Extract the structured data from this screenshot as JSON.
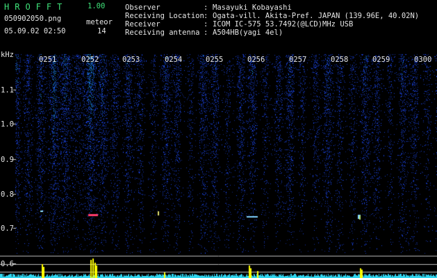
{
  "app": {
    "title": "HROFFT",
    "version": "1.00"
  },
  "capture": {
    "filename": "050902050.png",
    "datetime": "05.09.02 02:50",
    "meteor_label": "meteor",
    "meteor_count": "14"
  },
  "info": [
    {
      "key": "Observer",
      "value": "Masayuki Kobayashi"
    },
    {
      "key": "Receiving Location",
      "value": "Ogata-vill. Akita-Pref. JAPAN (139.96E, 40.02N)"
    },
    {
      "key": "Receiver",
      "value": "ICOM IC-575 53.7492(@LCD)MHz USB"
    },
    {
      "key": "Receiving antenna",
      "value": "A504HB(yagi 4el)"
    }
  ],
  "spectrogram": {
    "y_unit": "kHz",
    "y_ticks": [
      "1.1",
      "1.0",
      "0.9",
      "0.8",
      "0.7",
      "0.6"
    ],
    "time_labels": [
      "0251",
      "0252",
      "0253",
      "0254",
      "0255",
      "0256",
      "0257",
      "0258",
      "0259",
      "0300"
    ],
    "colors": {
      "background": "#000000",
      "noise": "#2140c8",
      "signal_peak": "#ff3b6b",
      "level_trace": "#2fd6f0",
      "level_peak": "#ffff00",
      "grid": "#cccccc"
    }
  }
}
